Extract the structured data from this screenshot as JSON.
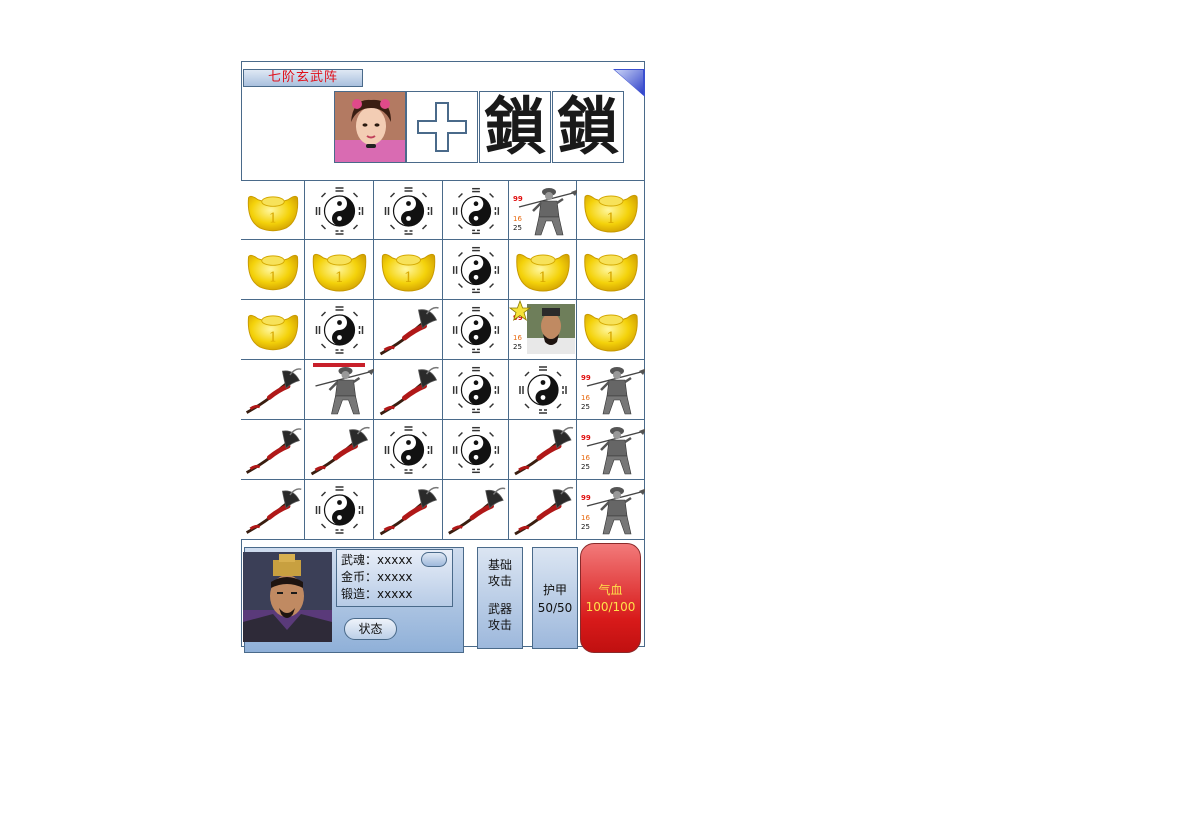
{
  "title": "七阶玄武阵",
  "top_slots": [
    {
      "kind": "portrait",
      "icon": "female-hero-portrait-icon"
    },
    {
      "kind": "add",
      "icon": "plus-icon"
    },
    {
      "kind": "lock",
      "text": "鎖"
    },
    {
      "kind": "lock",
      "text": "鎖"
    }
  ],
  "grid": {
    "rows": [
      [
        {
          "t": "gold"
        },
        {
          "t": "taiji"
        },
        {
          "t": "taiji"
        },
        {
          "t": "taiji"
        },
        {
          "t": "soldier",
          "stats": [
            "99",
            "16",
            "25"
          ]
        },
        {
          "t": "gold"
        }
      ],
      [
        {
          "t": "gold"
        },
        {
          "t": "gold"
        },
        {
          "t": "gold"
        },
        {
          "t": "taiji"
        },
        {
          "t": "gold"
        },
        {
          "t": "gold"
        }
      ],
      [
        {
          "t": "gold"
        },
        {
          "t": "taiji"
        },
        {
          "t": "weapon"
        },
        {
          "t": "taiji"
        },
        {
          "t": "player",
          "stats": [
            "99",
            "16",
            "25"
          ],
          "star": true
        },
        {
          "t": "gold"
        }
      ],
      [
        {
          "t": "weapon"
        },
        {
          "t": "soldier",
          "hpbar": true
        },
        {
          "t": "weapon"
        },
        {
          "t": "taiji"
        },
        {
          "t": "taiji"
        },
        {
          "t": "soldier",
          "stats": [
            "99",
            "16",
            "25"
          ]
        }
      ],
      [
        {
          "t": "weapon"
        },
        {
          "t": "weapon"
        },
        {
          "t": "taiji"
        },
        {
          "t": "taiji"
        },
        {
          "t": "weapon"
        },
        {
          "t": "soldier",
          "stats": [
            "99",
            "16",
            "25"
          ]
        }
      ],
      [
        {
          "t": "weapon"
        },
        {
          "t": "taiji"
        },
        {
          "t": "weapon"
        },
        {
          "t": "weapon"
        },
        {
          "t": "weapon"
        },
        {
          "t": "soldier",
          "stats": [
            "99",
            "16",
            "25"
          ]
        }
      ]
    ]
  },
  "player": {
    "soul_label": "武魂：",
    "soul_value": "xxxxx",
    "gold_label": "金币：",
    "gold_value": "xxxxx",
    "forge_label": "锻造：",
    "forge_value": "xxxxx",
    "status_button": "状态",
    "base_attack_line1": "基础",
    "base_attack_line2": "攻击",
    "weapon_attack_line1": "武器",
    "weapon_attack_line2": "攻击",
    "armor_label": "护甲",
    "armor_value": "50/50",
    "hp_label": "气血",
    "hp_value": "100/100"
  },
  "colors": {
    "title_red": "#e0101a",
    "border_blue": "#4a6a8a",
    "hp_red": "#d81a1a",
    "hp_text": "#ffe14a"
  }
}
